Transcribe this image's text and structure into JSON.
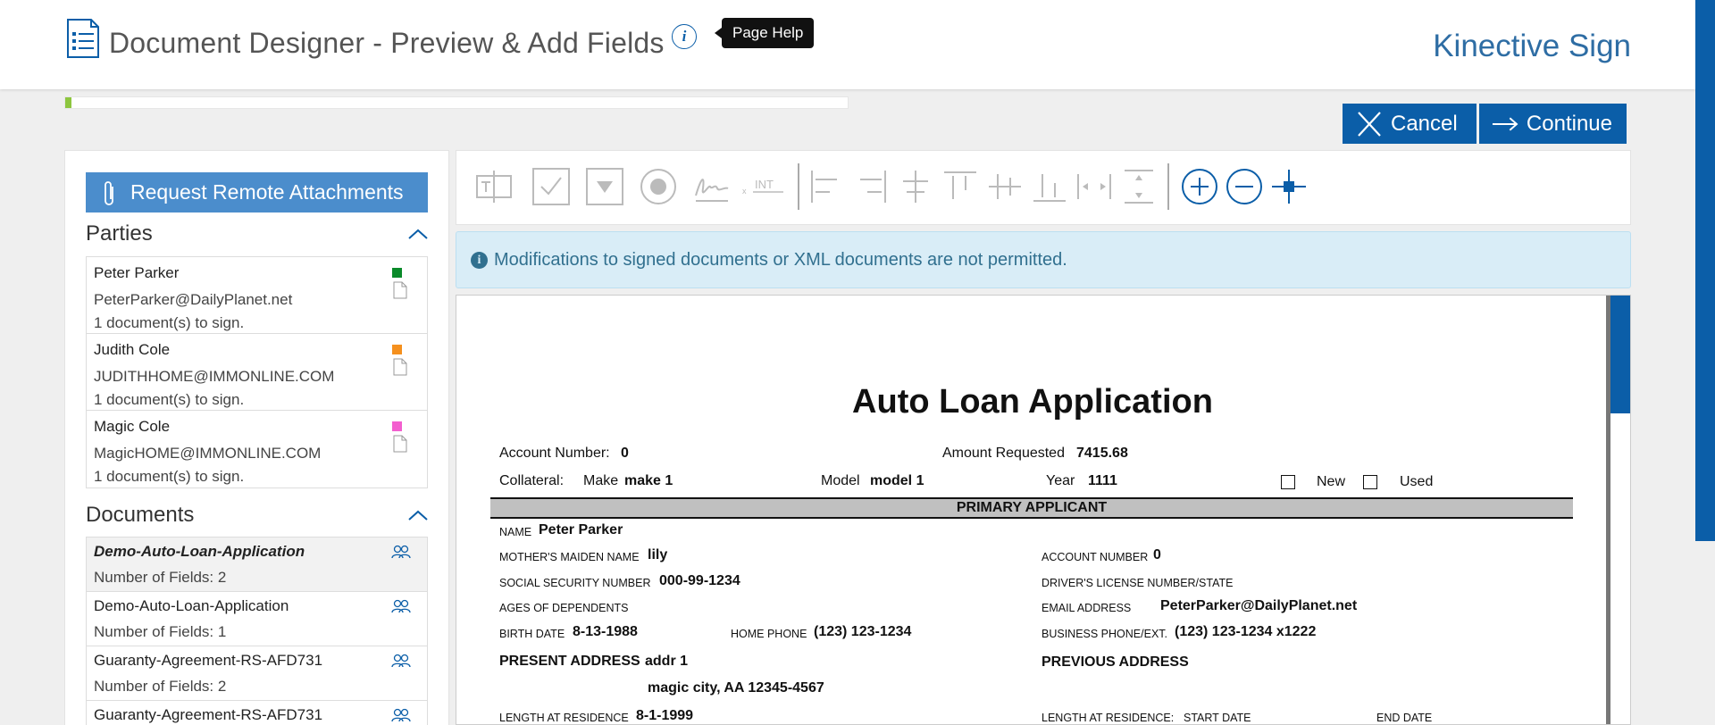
{
  "header": {
    "title": "Document Designer - Preview & Add Fields",
    "help_tooltip": "Page Help",
    "brand": "Kinective Sign"
  },
  "progress": {
    "value_percent": 1
  },
  "actions": {
    "cancel": "Cancel",
    "continue": "Continue"
  },
  "left_panel": {
    "remote_button": "Request Remote Attachments",
    "parties_heading": "Parties",
    "parties": [
      {
        "name": "Peter Parker",
        "email": "PeterParker@DailyPlanet.net",
        "count": "1 document(s) to sign.",
        "color": "#0a8a2a"
      },
      {
        "name": "Judith Cole",
        "email": "JUDITHHOME@IMMONLINE.COM",
        "count": "1 document(s) to sign.",
        "color": "#f5901e"
      },
      {
        "name": "Magic Cole",
        "email": "MagicHOME@IMMONLINE.COM",
        "count": "1 document(s) to sign.",
        "color": "#f35fcf"
      }
    ],
    "documents_heading": "Documents",
    "documents": [
      {
        "name": "Demo-Auto-Loan-Application",
        "fields": "Number of Fields: 2"
      },
      {
        "name": "Demo-Auto-Loan-Application",
        "fields": "Number of Fields: 1"
      },
      {
        "name": "Guaranty-Agreement-RS-AFD731",
        "fields": "Number of Fields: 2"
      },
      {
        "name": "Guaranty-Agreement-RS-AFD731",
        "fields": ""
      }
    ]
  },
  "toolbar": {
    "tools": [
      "text-field-icon",
      "checkbox-icon",
      "dropdown-icon",
      "radio-icon",
      "signature-icon",
      "initials-icon",
      "align-left-icon",
      "align-right-icon",
      "align-center-icon",
      "align-top-icon",
      "align-middle-icon",
      "align-bottom-icon",
      "distribute-horizontal-icon",
      "distribute-vertical-icon",
      "zoom-in-icon",
      "zoom-out-icon",
      "move-icon"
    ]
  },
  "alert": {
    "text": "Modifications to signed documents or XML documents are not permitted."
  },
  "document": {
    "title": "Auto Loan Application",
    "account_number_label": "Account Number:",
    "account_number": "0",
    "amount_label": "Amount Requested",
    "amount": "7415.68",
    "collateral_label": "Collateral:",
    "make_label": "Make",
    "make": "make 1",
    "model_label": "Model",
    "model": "model 1",
    "year_label": "Year",
    "year": "1111",
    "new_label": "New",
    "used_label": "Used",
    "band": "PRIMARY APPLICANT",
    "name_label": "NAME",
    "name": "Peter Parker",
    "maiden_label": "MOTHER'S MAIDEN NAME",
    "maiden": "lily",
    "acct_label": "ACCOUNT NUMBER",
    "acct": "0",
    "ssn_label": "SOCIAL SECURITY NUMBER",
    "ssn": "000-99-1234",
    "dl_label": "DRIVER'S LICENSE NUMBER/STATE",
    "ages_label": "AGES OF DEPENDENTS",
    "email_label": "EMAIL ADDRESS",
    "email": "PeterParker@DailyPlanet.net",
    "birth_label": "BIRTH DATE",
    "birth": "8-13-1988",
    "home_phone_label": "HOME PHONE",
    "home_phone": "(123) 123-1234",
    "biz_phone_label": "BUSINESS PHONE/EXT.",
    "biz_phone": "(123) 123-1234 x1222",
    "present_label": "PRESENT ADDRESS",
    "present_line1": "addr 1",
    "present_line2": "magic city, AA 12345-4567",
    "previous_label": "PREVIOUS ADDRESS",
    "length_label": "LENGTH AT RESIDENCE",
    "length": "8-1-1999",
    "length_label2": "LENGTH AT RESIDENCE:",
    "start_label": "START DATE",
    "end_label": "END DATE"
  }
}
